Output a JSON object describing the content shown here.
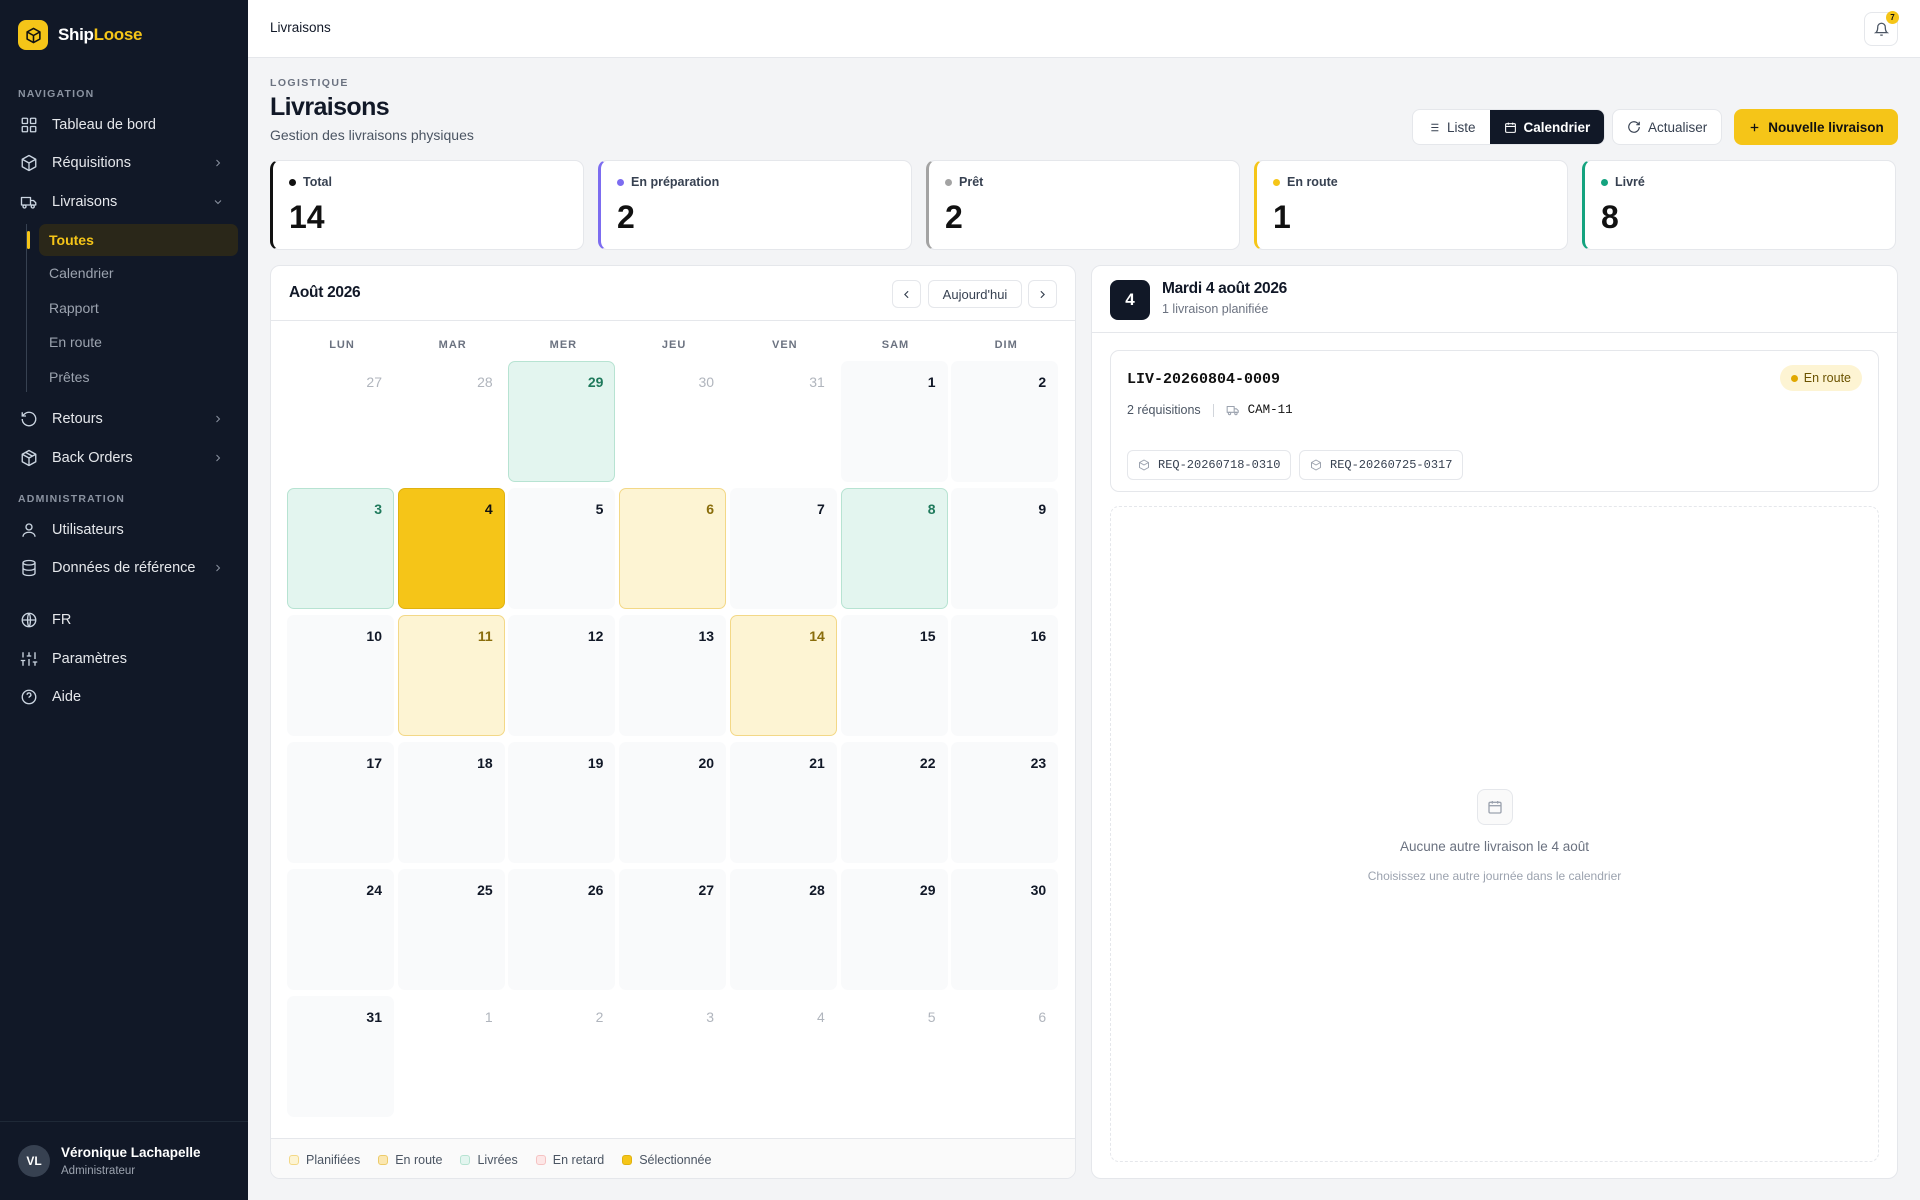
{
  "app": {
    "brand_a": "Ship",
    "brand_b": "Loose",
    "brand_color": "#f5c518"
  },
  "sidebar": {
    "nav_label": "NAVIGATION",
    "admin_label": "ADMINISTRATION",
    "items": [
      {
        "label": "Tableau de bord",
        "icon": "grid-icon"
      },
      {
        "label": "Réquisitions",
        "icon": "box-icon"
      },
      {
        "label": "Livraisons",
        "icon": "truck-icon"
      },
      {
        "label": "Retours",
        "icon": "return-icon"
      },
      {
        "label": "Back Orders",
        "icon": "package-icon"
      },
      {
        "label": "Utilisateurs",
        "icon": "user-icon"
      },
      {
        "label": "Données de référence",
        "icon": "database-icon"
      },
      {
        "label": "FR",
        "icon": "globe-icon"
      },
      {
        "label": "Paramètres",
        "icon": "sliders-icon"
      },
      {
        "label": "Aide",
        "icon": "help-icon"
      }
    ],
    "sub_items": [
      "Toutes",
      "Calendrier",
      "Rapport",
      "En route",
      "Prêtes"
    ],
    "user": {
      "initials": "VL",
      "name": "Véronique Lachapelle",
      "role": "Administrateur"
    }
  },
  "topbar": {
    "breadcrumb": "Livraisons",
    "notifications": "7"
  },
  "header": {
    "eyebrow": "LOGISTIQUE",
    "title": "Livraisons",
    "subtitle": "Gestion des livraisons physiques",
    "view_list": "Liste",
    "view_calendar": "Calendrier",
    "refresh": "Actualiser",
    "new": "Nouvelle livraison"
  },
  "stats": [
    {
      "label": "Total",
      "value": "14",
      "color": "#111111"
    },
    {
      "label": "En préparation",
      "value": "2",
      "color": "#7c6cf0"
    },
    {
      "label": "Prêt",
      "value": "2",
      "color": "#a3a3a3"
    },
    {
      "label": "En route",
      "value": "1",
      "color": "#f5c518"
    },
    {
      "label": "Livré",
      "value": "8",
      "color": "#14a37f"
    }
  ],
  "calendar": {
    "month": "Août 2026",
    "today": "Aujourd'hui",
    "weekdays": [
      "LUN",
      "MAR",
      "MER",
      "JEU",
      "VEN",
      "SAM",
      "DIM"
    ],
    "days": [
      {
        "n": "27",
        "s": "other"
      },
      {
        "n": "28",
        "s": "other"
      },
      {
        "n": "29",
        "s": "livree"
      },
      {
        "n": "30",
        "s": "other"
      },
      {
        "n": "31",
        "s": "other"
      },
      {
        "n": "1",
        "s": ""
      },
      {
        "n": "2",
        "s": ""
      },
      {
        "n": "3",
        "s": "livree"
      },
      {
        "n": "4",
        "s": "sel"
      },
      {
        "n": "5",
        "s": ""
      },
      {
        "n": "6",
        "s": "enroute"
      },
      {
        "n": "7",
        "s": ""
      },
      {
        "n": "8",
        "s": "livree"
      },
      {
        "n": "9",
        "s": ""
      },
      {
        "n": "10",
        "s": ""
      },
      {
        "n": "11",
        "s": "enroute"
      },
      {
        "n": "12",
        "s": ""
      },
      {
        "n": "13",
        "s": ""
      },
      {
        "n": "14",
        "s": "enroute"
      },
      {
        "n": "15",
        "s": ""
      },
      {
        "n": "16",
        "s": ""
      },
      {
        "n": "17",
        "s": ""
      },
      {
        "n": "18",
        "s": ""
      },
      {
        "n": "19",
        "s": ""
      },
      {
        "n": "20",
        "s": ""
      },
      {
        "n": "21",
        "s": ""
      },
      {
        "n": "22",
        "s": ""
      },
      {
        "n": "23",
        "s": ""
      },
      {
        "n": "24",
        "s": ""
      },
      {
        "n": "25",
        "s": ""
      },
      {
        "n": "26",
        "s": ""
      },
      {
        "n": "27",
        "s": ""
      },
      {
        "n": "28",
        "s": ""
      },
      {
        "n": "29",
        "s": ""
      },
      {
        "n": "30",
        "s": ""
      },
      {
        "n": "31",
        "s": ""
      },
      {
        "n": "1",
        "s": "other"
      },
      {
        "n": "2",
        "s": "other"
      },
      {
        "n": "3",
        "s": "other"
      },
      {
        "n": "4",
        "s": "other"
      },
      {
        "n": "5",
        "s": "other"
      },
      {
        "n": "6",
        "s": "other"
      }
    ],
    "legend": [
      {
        "label": "Planifiées",
        "bg": "#fdf4d3",
        "border": "#f3d887"
      },
      {
        "label": "En route",
        "bg": "#fbe7b0",
        "border": "#eccb6a"
      },
      {
        "label": "Livrées",
        "bg": "#e3f5ef",
        "border": "#b7e3d2"
      },
      {
        "label": "En retard",
        "bg": "#fde7e7",
        "border": "#f5c2c2"
      },
      {
        "label": "Sélectionnée",
        "bg": "#f5c518",
        "border": "#e0b210"
      }
    ]
  },
  "detail": {
    "day": "4",
    "title": "Mardi 4 août 2026",
    "subtitle": "1 livraison planifiée",
    "shipment": {
      "id": "LIV-20260804-0009",
      "status": "En route",
      "requisitions": "2 réquisitions",
      "truck": "CAM-11",
      "tags": [
        "REQ-20260718-0310",
        "REQ-20260725-0317"
      ]
    },
    "empty_title": "Aucune autre livraison le 4 août",
    "empty_sub": "Choisissez une autre journée dans le calendrier"
  }
}
